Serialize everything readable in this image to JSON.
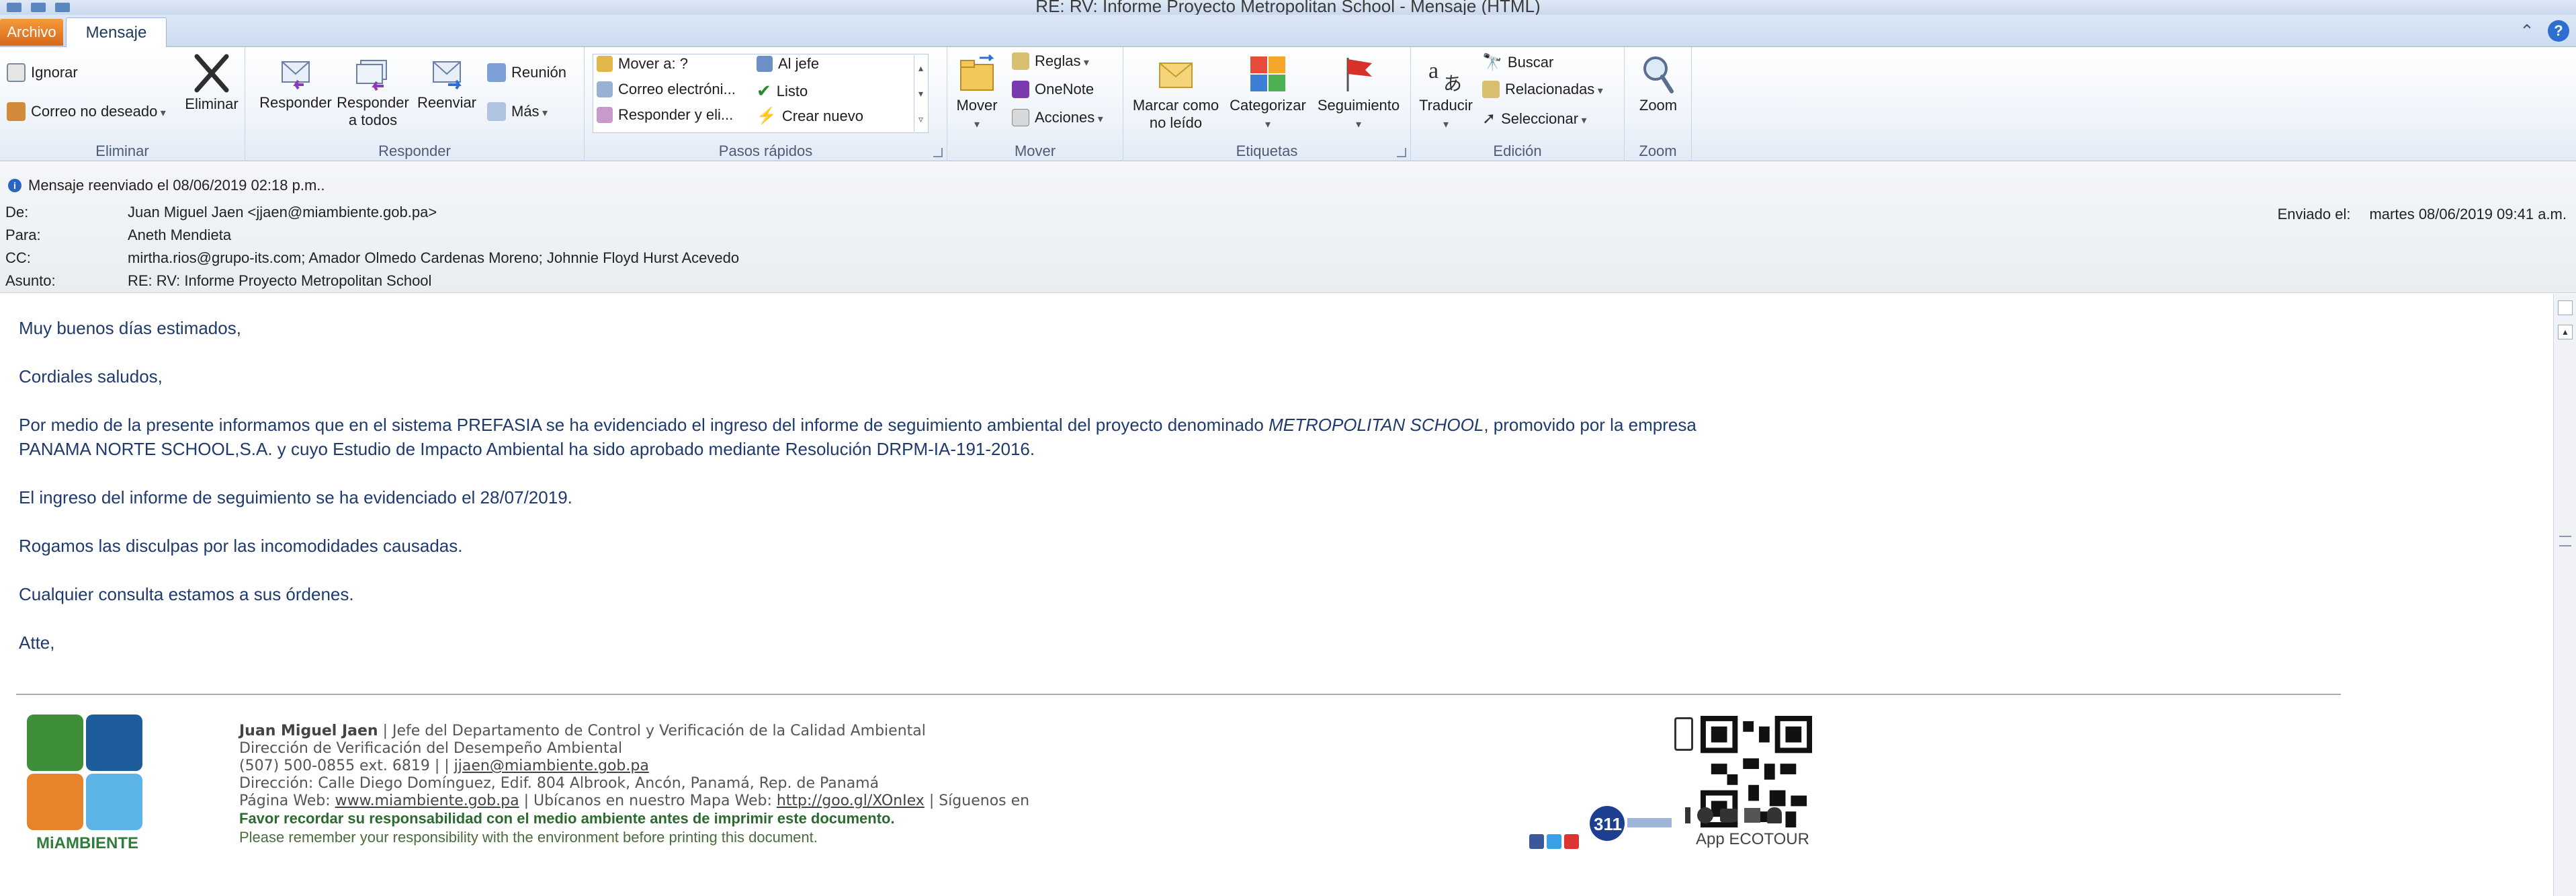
{
  "window": {
    "title": "RE: RV: Informe Proyecto Metropolitan School - Mensaje (HTML)"
  },
  "tabs": {
    "file": "Archivo",
    "message": "Mensaje"
  },
  "ribbon": {
    "delete_group": {
      "label": "Eliminar",
      "ignore": "Ignorar",
      "junk": "Correo no deseado",
      "delete": "Eliminar"
    },
    "respond_group": {
      "label": "Responder",
      "reply": "Responder",
      "reply_all_1": "Responder",
      "reply_all_2": "a todos",
      "forward": "Reenviar",
      "meeting": "Reunión",
      "more": "Más"
    },
    "quicksteps_group": {
      "label": "Pasos rápidos",
      "items": [
        "Mover a: ?",
        "Al jefe",
        "Correo electróni...",
        "Listo",
        "Responder y eli...",
        "Crear nuevo"
      ]
    },
    "move_group": {
      "label": "Mover",
      "move": "Mover",
      "rules": "Reglas",
      "onenote": "OneNote",
      "actions": "Acciones"
    },
    "tags_group": {
      "label": "Etiquetas",
      "mark_unread_1": "Marcar como",
      "mark_unread_2": "no leído",
      "categorize": "Categorizar",
      "followup": "Seguimiento"
    },
    "edit_group": {
      "label": "Edición",
      "translate": "Traducir",
      "find": "Buscar",
      "related": "Relacionadas",
      "select": "Seleccionar"
    },
    "zoom_group": {
      "label": "Zoom",
      "zoom": "Zoom"
    }
  },
  "header": {
    "forwarded": "Mensaje reenviado el 08/06/2019 02:18 p.m..",
    "from_label": "De:",
    "from": "Juan Miguel Jaen <jjaen@miambiente.gob.pa>",
    "to_label": "Para:",
    "to": "Aneth Mendieta",
    "cc_label": "CC:",
    "cc": "mirtha.rios@grupo-its.com; Amador Olmedo Cardenas Moreno; Johnnie Floyd Hurst Acevedo",
    "subject_label": "Asunto:",
    "subject": "RE: RV: Informe Proyecto Metropolitan School",
    "sent_label": "Enviado el:",
    "sent": "martes 08/06/2019 09:41 a.m."
  },
  "body": {
    "greeting": "Muy buenos días estimados,",
    "regards": "Cordiales saludos,",
    "p1_a": "Por medio de la presente informamos que en el sistema PREFASIA se ha evidenciado el ingreso del informe de seguimiento ambiental del proyecto denominado ",
    "p1_italic": "METROPOLITAN SCHOOL",
    "p1_b": ", promovido por la empresa",
    "p1_line2": "PANAMA NORTE SCHOOL,S.A. y cuyo Estudio de Impacto Ambiental ha sido aprobado mediante Resolución DRPM-IA-191-2016.",
    "p2": "El ingreso del informe de seguimiento se ha evidenciado el 28/07/2019.",
    "p3": "Rogamos las disculpas por las incomodidades causadas.",
    "p4": "Cualquier consulta estamos a sus órdenes.",
    "closing": "Atte,"
  },
  "signature": {
    "logo_text": "MiAMBIENTE",
    "name": "Juan Miguel Jaen",
    "role": "  |  Jefe del Departamento de Control y Verificación de la Calidad Ambiental",
    "dept": "Dirección de Verificación del Desempeño Ambiental",
    "phone": "(507) 500-0855 ext. 6819 |  | ",
    "email": "jjaen@miambiente.gob.pa",
    "address": "Dirección: Calle Diego Domínguez, Edif. 804 Albrook, Ancón, Panamá, Rep. de  Panamá",
    "web_label": "Página Web: ",
    "web": "www.miambiente.gob.pa",
    "map_label": " | Ubícanos en nuestro Mapa Web: ",
    "map": "http://goo.gl/XOnIex",
    "follow": " | Síguenos en",
    "eco_es": "Favor recordar su responsabilidad con el medio ambiente antes de imprimir este documento.",
    "eco_en": "Please remember your responsibility with the environment before printing this document.",
    "app": "App ECOTOUR"
  },
  "colors": {
    "accent": "#2c6fcf",
    "file_tab": "#e07a22",
    "body_text": "#1f3a6e"
  }
}
